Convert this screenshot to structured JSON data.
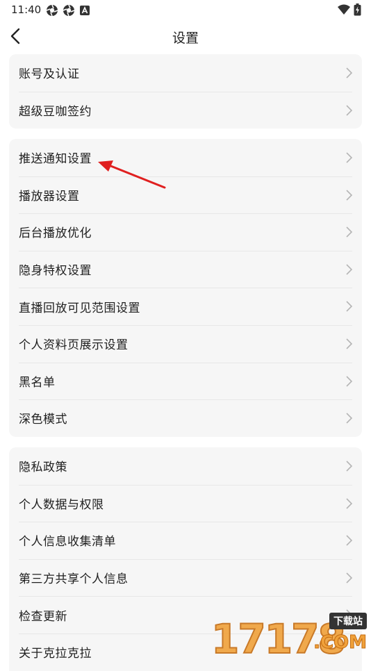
{
  "status_bar": {
    "time": "11:40",
    "left_icons": [
      "aperture-icon",
      "aperture-icon",
      "a-box-icon"
    ],
    "right_icons": [
      "wifi-icon",
      "battery-charging-icon"
    ]
  },
  "header": {
    "title": "设置"
  },
  "groups": [
    {
      "items": [
        {
          "label": "账号及认证"
        },
        {
          "label": "超级豆咖签约"
        }
      ]
    },
    {
      "items": [
        {
          "label": "推送通知设置"
        },
        {
          "label": "播放器设置"
        },
        {
          "label": "后台播放优化"
        },
        {
          "label": "隐身特权设置"
        },
        {
          "label": "直播回放可见范围设置"
        },
        {
          "label": "个人资料页展示设置"
        },
        {
          "label": "黑名单"
        },
        {
          "label": "深色模式"
        }
      ]
    },
    {
      "items": [
        {
          "label": "隐私政策"
        },
        {
          "label": "个人数据与权限"
        },
        {
          "label": "个人信息收集清单"
        },
        {
          "label": "第三方共享个人信息"
        },
        {
          "label": "检查更新"
        },
        {
          "label": "关于克拉克拉"
        }
      ]
    }
  ],
  "annotation": {
    "color": "#e02020"
  },
  "watermark": {
    "digits": "17178",
    "tag": "下载站",
    "suffix": ".COM"
  }
}
